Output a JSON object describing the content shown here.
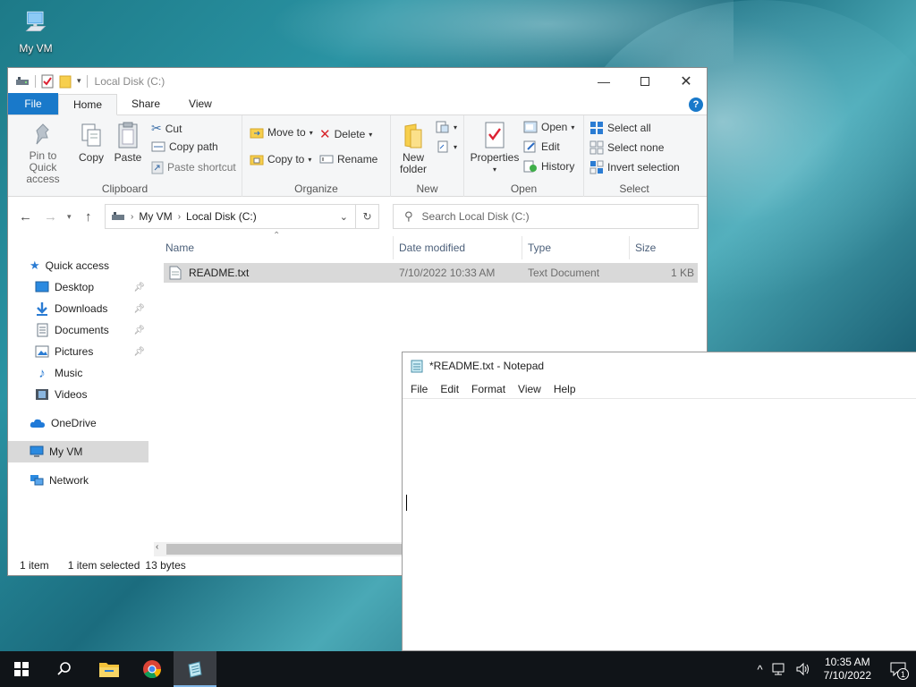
{
  "desktop": {
    "icons": [
      {
        "label": "My VM",
        "icon": "computer-icon"
      }
    ]
  },
  "explorer": {
    "title": "Local Disk (C:)",
    "tabs": [
      {
        "label": "File"
      },
      {
        "label": "Home"
      },
      {
        "label": "Share"
      },
      {
        "label": "View"
      }
    ],
    "ribbon": {
      "clipboard": {
        "label": "Clipboard",
        "pin": "Pin to Quick access",
        "copy": "Copy",
        "paste": "Paste",
        "cut": "Cut",
        "copy_path": "Copy path",
        "paste_shortcut": "Paste shortcut"
      },
      "organize": {
        "label": "Organize",
        "move_to": "Move to",
        "copy_to": "Copy to",
        "delete": "Delete",
        "rename": "Rename"
      },
      "new": {
        "label": "New",
        "new_folder": "New folder"
      },
      "open": {
        "label": "Open",
        "properties": "Properties",
        "open": "Open",
        "edit": "Edit",
        "history": "History"
      },
      "select": {
        "label": "Select",
        "select_all": "Select all",
        "select_none": "Select none",
        "invert": "Invert selection"
      }
    },
    "address": {
      "path": [
        "My VM",
        "Local Disk (C:)"
      ],
      "search_placeholder": "Search Local Disk (C:)"
    },
    "nav": {
      "quick_access": "Quick access",
      "items": [
        {
          "label": "Desktop",
          "pinned": true
        },
        {
          "label": "Downloads",
          "pinned": true
        },
        {
          "label": "Documents",
          "pinned": true
        },
        {
          "label": "Pictures",
          "pinned": true
        },
        {
          "label": "Music",
          "pinned": false
        },
        {
          "label": "Videos",
          "pinned": false
        }
      ],
      "onedrive": "OneDrive",
      "myvm": "My VM",
      "network": "Network"
    },
    "columns": {
      "name": "Name",
      "date": "Date modified",
      "type": "Type",
      "size": "Size"
    },
    "files": [
      {
        "name": "README.txt",
        "date": "7/10/2022 10:33 AM",
        "type": "Text Document",
        "size": "1 KB"
      }
    ],
    "status": {
      "count": "1 item",
      "selected": "1 item selected",
      "bytes": "13 bytes"
    }
  },
  "notepad": {
    "title": "*README.txt - Notepad",
    "menu": [
      "File",
      "Edit",
      "Format",
      "View",
      "Help"
    ],
    "text": ""
  },
  "taskbar": {
    "time": "10:35 AM",
    "date": "7/10/2022",
    "notifications": "1"
  },
  "colors": {
    "accent": "#1979ca",
    "selection": "#d9d9d9",
    "taskbar": "#101418"
  }
}
